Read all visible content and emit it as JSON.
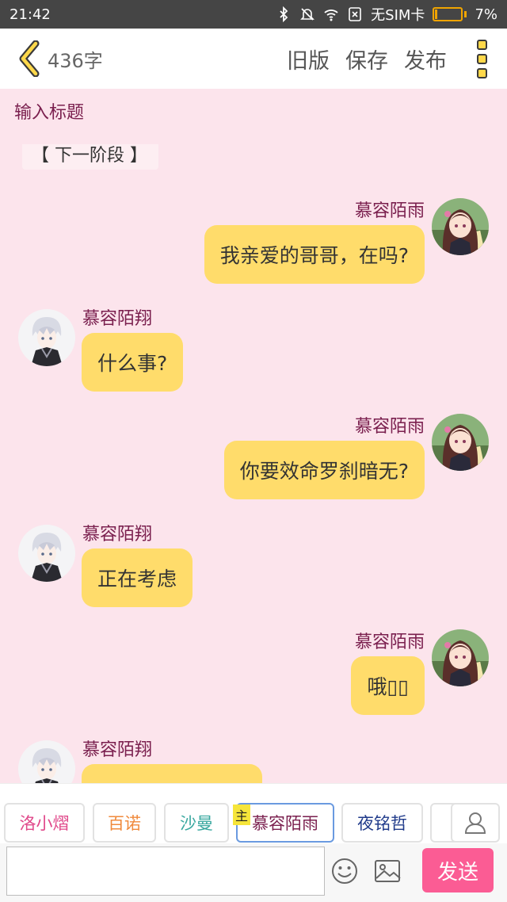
{
  "status_bar": {
    "time": "21:42",
    "sim": "无SIM卡",
    "battery": "7%",
    "battery_level": 0.07,
    "icons": [
      "bluetooth-icon",
      "mute-icon",
      "wifi-icon",
      "sim-missing-icon",
      "battery-icon"
    ]
  },
  "top_bar": {
    "word_count": "436字",
    "actions": {
      "old_version": "旧版",
      "save": "保存",
      "publish": "发布"
    }
  },
  "title_input": {
    "placeholder": "输入标题",
    "value": ""
  },
  "stage_chip": {
    "label": "【 下一阶段 】"
  },
  "messages": [
    {
      "side": "right",
      "name": "慕容陌雨",
      "text": "我亲爱的哥哥，在吗?"
    },
    {
      "side": "left",
      "name": "慕容陌翔",
      "text": "什么事?"
    },
    {
      "side": "right",
      "name": "慕容陌雨",
      "text": "你要效命罗刹暗无?"
    },
    {
      "side": "left",
      "name": "慕容陌翔",
      "text": "正在考虑"
    },
    {
      "side": "right",
      "name": "慕容陌雨",
      "text": "哦▯▯"
    },
    {
      "side": "left",
      "name": "慕容陌翔",
      "text": ""
    }
  ],
  "cast_bar": {
    "characters": [
      {
        "name": "洛小熠",
        "color": "#e0488a",
        "active": false
      },
      {
        "name": "百诺",
        "color": "#f08a3c",
        "active": false
      },
      {
        "name": "沙曼",
        "color": "#3aa8a0",
        "active": false
      },
      {
        "name": "慕容陌雨",
        "color": "#7a1f4e",
        "active": true
      },
      {
        "name": "夜铭哲",
        "color": "#1f3a8a",
        "active": false
      },
      {
        "name": "",
        "color": "#d068d8",
        "active": false
      }
    ],
    "host_badge": "主"
  },
  "input_bar": {
    "placeholder": "",
    "send": "发送"
  },
  "colors": {
    "background": "#fce4ec",
    "bubble": "#ffdc6b",
    "name": "#7a1f4e",
    "send": "#fb5c94",
    "accent_yellow": "#ffd84a"
  }
}
